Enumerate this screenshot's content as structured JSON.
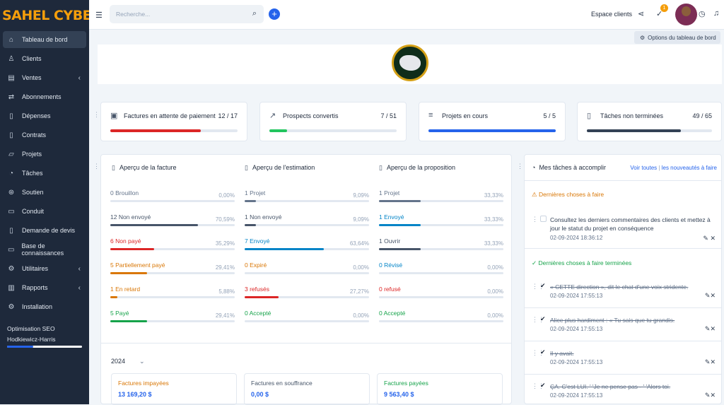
{
  "brand": "SAHEL CYBER",
  "sidebar": {
    "items": [
      {
        "label": "Tableau de bord",
        "icon": "home-icon"
      },
      {
        "label": "Clients",
        "icon": "user-icon"
      },
      {
        "label": "Ventes",
        "icon": "receipt-icon"
      },
      {
        "label": "Abonnements",
        "icon": "refresh-icon"
      },
      {
        "label": "Dépenses",
        "icon": "document-icon"
      },
      {
        "label": "Contrats",
        "icon": "contract-icon"
      },
      {
        "label": "Projets",
        "icon": "chart-icon"
      },
      {
        "label": "Tâches",
        "icon": "check-circle-icon"
      },
      {
        "label": "Soutien",
        "icon": "lifebuoy-icon"
      },
      {
        "label": "Conduit",
        "icon": "lead-icon"
      },
      {
        "label": "Demande de devis",
        "icon": "file-icon"
      },
      {
        "label": "Base de connaissances",
        "icon": "folder-icon"
      },
      {
        "label": "Utilitaires",
        "icon": "cogs-icon"
      },
      {
        "label": "Rapports",
        "icon": "bar-chart-icon"
      },
      {
        "label": "Installation",
        "icon": "gear-icon"
      }
    ],
    "seo": {
      "title": "Optimisation SEO",
      "name": "Hodkiewicz-Harris",
      "progress": 0.35
    }
  },
  "topbar": {
    "search_placeholder": "Recherche...",
    "client_space": "Espace clients",
    "notif_count": "1"
  },
  "dashboard_options": "Options du tableau de bord",
  "stats": [
    {
      "label": "Factures en attente de paiement",
      "value": "12 / 17",
      "progress": 0.71,
      "color": "#dc2626"
    },
    {
      "label": "Prospects convertis",
      "value": "7 / 51",
      "progress": 0.14,
      "color": "#22c55e"
    },
    {
      "label": "Projets en cours",
      "value": "5 / 5",
      "progress": 1.0,
      "color": "#2563eb"
    },
    {
      "label": "Tâches non terminées",
      "value": "49 / 65",
      "progress": 0.75,
      "color": "#334155"
    }
  ],
  "overview": [
    {
      "title": "Aperçu de la facture",
      "rows": [
        {
          "label": "0 Brouillon",
          "pct": "0,00%",
          "value": 0,
          "color": "#64748b"
        },
        {
          "label": "12 Non envoyé",
          "pct": "70,59%",
          "value": 70.59,
          "color": "#475569"
        },
        {
          "label": "6 Non payé",
          "pct": "35,29%",
          "value": 35.29,
          "color": "#dc2626"
        },
        {
          "label": "5 Partiellement payé",
          "pct": "29,41%",
          "value": 29.41,
          "color": "#d97706"
        },
        {
          "label": "1 En retard",
          "pct": "5,88%",
          "value": 5.88,
          "color": "#d97706"
        },
        {
          "label": "5 Payé",
          "pct": "29,41%",
          "value": 29.41,
          "color": "#16a34a"
        }
      ]
    },
    {
      "title": "Aperçu de l'estimation",
      "rows": [
        {
          "label": "1 Projet",
          "pct": "9,09%",
          "value": 9.09,
          "color": "#64748b"
        },
        {
          "label": "1 Non envoyé",
          "pct": "9,09%",
          "value": 9.09,
          "color": "#475569"
        },
        {
          "label": "7 Envoyé",
          "pct": "63,64%",
          "value": 63.64,
          "color": "#0284c7"
        },
        {
          "label": "0 Expiré",
          "pct": "0,00%",
          "value": 0,
          "color": "#d97706"
        },
        {
          "label": "3 refusés",
          "pct": "27,27%",
          "value": 27.27,
          "color": "#dc2626"
        },
        {
          "label": "0 Accepté",
          "pct": "0,00%",
          "value": 0,
          "color": "#16a34a"
        }
      ]
    },
    {
      "title": "Aperçu de la proposition",
      "rows": [
        {
          "label": "1 Projet",
          "pct": "33,33%",
          "value": 33.33,
          "color": "#64748b"
        },
        {
          "label": "1 Envoyé",
          "pct": "33,33%",
          "value": 33.33,
          "color": "#0284c7"
        },
        {
          "label": "1 Ouvrir",
          "pct": "33,33%",
          "value": 33.33,
          "color": "#475569"
        },
        {
          "label": "0 Révisé",
          "pct": "0,00%",
          "value": 0,
          "color": "#0284c7"
        },
        {
          "label": "0 refusé",
          "pct": "0,00%",
          "value": 0,
          "color": "#dc2626"
        },
        {
          "label": "0 Accepté",
          "pct": "0,00%",
          "value": 0,
          "color": "#16a34a"
        }
      ]
    }
  ],
  "year": "2024",
  "summary": [
    {
      "label": "Factures impayées",
      "value": "13 169,20 $",
      "label_color": "#d97706",
      "value_color": "#2563eb"
    },
    {
      "label": "Factures en souffrance",
      "value": "0,00 $",
      "label_color": "#475569",
      "value_color": "#2563eb"
    },
    {
      "label": "Factures payées",
      "value": "9 563,40 $",
      "label_color": "#16a34a",
      "value_color": "#2563eb"
    }
  ],
  "tasks": {
    "title": "Mes tâches à accomplir",
    "see_all": "Voir toutes",
    "sep": "|",
    "new_link": "les nouveautés à faire",
    "pending_title": "Dernières choses à faire",
    "done_title": "Dernières choses à faire terminées",
    "pending": [
      {
        "text": "Consultez les derniers commentaires des clients et mettez à jour le statut du projet en conséquence",
        "date": "02-09-2024 18:36:12"
      }
    ],
    "done": [
      {
        "text": "« CETTE direction », dit le chat d'une voix stridente.",
        "date": "02-09-2024 17:55:13"
      },
      {
        "text": "Alice plus hardiment : « Tu sais que tu grandis.",
        "date": "02-09-2024 17:55:13"
      },
      {
        "text": "Il y avait.",
        "date": "02-09-2024 17:55:13"
      },
      {
        "text": "ÇA. C'est LUI. ' 'Je ne pense pas - ' 'Alors toi.",
        "date": "02-09-2024 17:55:13"
      }
    ]
  }
}
